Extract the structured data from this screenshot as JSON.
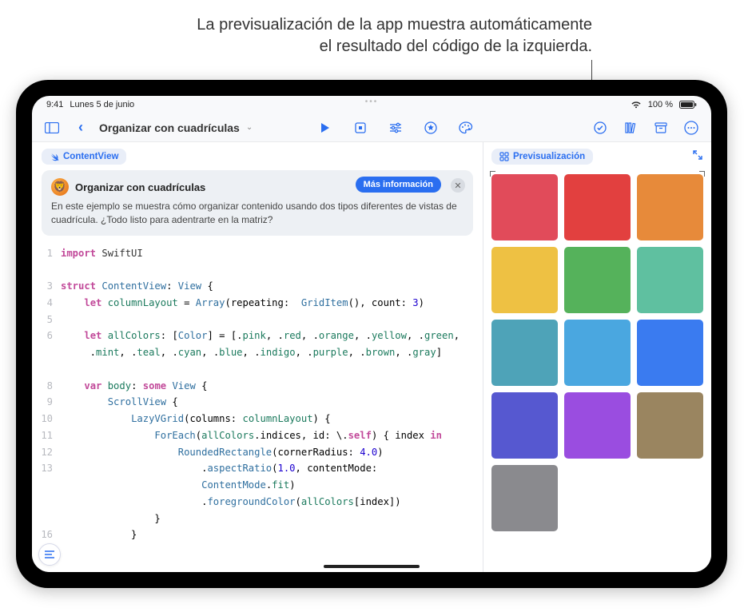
{
  "annotation": {
    "line1": "La previsualización de la app muestra automáticamente",
    "line2": "el resultado del código de la izquierda."
  },
  "status": {
    "time": "9:41",
    "date": "Lunes 5 de junio",
    "battery": "100 %"
  },
  "toolbar": {
    "title": "Organizar con cuadrículas"
  },
  "file_tab": "ContentView",
  "preview_tab": "Previsualización",
  "info_card": {
    "title": "Organizar con cuadrículas",
    "more": "Más información",
    "desc": "En este ejemplo se muestra cómo organizar contenido usando dos tipos diferentes de vistas de cuadrícula. ¿Todo listo para adentrarte en la matriz?"
  },
  "code": {
    "l1": "import SwiftUI",
    "l2": "",
    "l3": "struct ContentView: View {",
    "l4": "    let columnLayout = Array(repeating:  GridItem(), count: 3)",
    "l5": "",
    "l6a": "    let allColors: [Color] = [.pink, .red, .orange, .yellow, .green,",
    "l6b": "     .mint, .teal, .cyan, .blue, .indigo, .purple, .brown, .gray]",
    "l7": "",
    "l8": "    var body: some View {",
    "l9": "        ScrollView {",
    "l10": "            LazyVGrid(columns: columnLayout) {",
    "l11": "                ForEach(allColors.indices, id: \\.self) { index in",
    "l12": "                    RoundedRectangle(cornerRadius: 4.0)",
    "l13": "                        .aspectRatio(1.0, contentMode:",
    "l13b": "                        ContentMode.fit)",
    "l14": "                        .foregroundColor(allColors[index])",
    "l15": "                }",
    "l16": "            }"
  },
  "colors": {
    "pink": "#e14b5a",
    "red": "#e2403f",
    "orange": "#e78a3a",
    "yellow": "#eec143",
    "green": "#55b25b",
    "mint": "#5fc0a0",
    "teal": "#4ea3b8",
    "cyan": "#4aa7e0",
    "blue": "#3a7bf0",
    "indigo": "#5658d0",
    "purple": "#9a4de0",
    "brown": "#9a8560",
    "gray": "#8a8a8e"
  }
}
